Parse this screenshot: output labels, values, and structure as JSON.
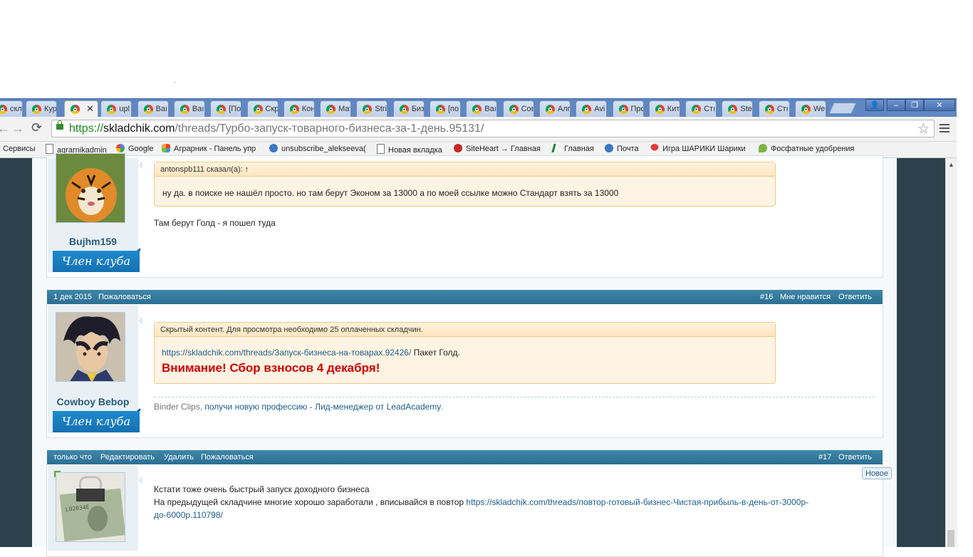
{
  "browser": {
    "tabs": [
      {
        "title": "скл"
      },
      {
        "title": "Кур"
      },
      {
        "title": ""
      },
      {
        "title": "upl"
      },
      {
        "title": "Ваı"
      },
      {
        "title": "Ваı"
      },
      {
        "title": "[По"
      },
      {
        "title": "Скр"
      },
      {
        "title": "Кон"
      },
      {
        "title": "Мат"
      },
      {
        "title": "Stri"
      },
      {
        "title": "Биз"
      },
      {
        "title": "[по"
      },
      {
        "title": "Ваı"
      },
      {
        "title": "Сов"
      },
      {
        "title": "Алг"
      },
      {
        "title": "Avi"
      },
      {
        "title": "Про"
      },
      {
        "title": "Кит"
      },
      {
        "title": "Стı"
      },
      {
        "title": "Ste"
      },
      {
        "title": "Стı"
      },
      {
        "title": "We"
      }
    ],
    "active_tab_close": "✕",
    "window_controls": {
      "user": "👤",
      "minimize": "‒",
      "restore": "❐",
      "close": "✕"
    },
    "url": {
      "scheme": "https://",
      "host": "skladchik.com",
      "path": "/threads/Турбо-запуск-товарного-бизнеса-за-1-день.95131/"
    },
    "nav": {
      "back": "←",
      "forward": "→",
      "reload": "C",
      "star": "☆"
    },
    "bookmarks": [
      {
        "label": "Сервисы",
        "icon": "apps-icon"
      },
      {
        "label": "agrarnikadmin",
        "icon": "page-icon"
      },
      {
        "label": "Google",
        "icon": "google-icon"
      },
      {
        "label": "Аграрник - Панель упр",
        "icon": "joomla-icon"
      },
      {
        "label": "unsubscribe_alekseeva(",
        "icon": "mail-icon"
      },
      {
        "label": "Новая вкладка",
        "icon": "page-icon"
      },
      {
        "label": "SiteHeart → Главная",
        "icon": "siteheart-icon"
      },
      {
        "label": "Главная",
        "icon": "a-icon"
      },
      {
        "label": "Почта",
        "icon": "mail-icon"
      },
      {
        "label": "Игра ШАРИКИ Шарики",
        "icon": "mushroom-icon"
      },
      {
        "label": "Фосфатные удобрения",
        "icon": "plant-icon"
      }
    ]
  },
  "posts": [
    {
      "username": "Bujhm159",
      "badge": "Член клуба",
      "quote_author": "antonspb111 сказал(а): ↑",
      "quote_text": "ну да. в поиске не нашёл просто. но там берут Эконом за 13000 а по моей ссылке можно Стандарт взять за 13000",
      "body": "Там берут Голд - я пошел туда"
    },
    {
      "date": "1 дек 2015",
      "report": "Пожаловаться",
      "number": "#16",
      "like": "Мне нравится",
      "reply": "Ответить",
      "username": "Cowboy Bebop",
      "badge": "Член клуба",
      "hidden_head": "Скрытый контент. Для просмотра необходимо 25 оплаченных складчин.",
      "hidden_link": "https://skladchik.com/threads/Запуск-бизнеса-на-товарах.92426/",
      "hidden_link_suffix": " Пакет Голд.",
      "hidden_warning": "Внимание! Сбор взносов 4 декабря!",
      "signature_prefix": "Binder Clips, ",
      "signature_link": "получи новую профессию - Лид-менеджер от LeadAcademy",
      "signature_suffix": "."
    },
    {
      "date": "только что",
      "edit": "Редактировать",
      "delete": "Удалить",
      "report": "Пожаловаться",
      "number": "#17",
      "reply": "Ответить",
      "new_badge": "Новое",
      "line1": "Кстати тоже очень быстрый запуск доходного бизнеса",
      "line2_prefix": "На предыдущей складчине многие хорошо заработали , вписывайся в повтор ",
      "line2_link_a": "https://skladchik.com/threads/повтор-готовый-бизнес-Чистая-прибыль-в-день-от-3000р-",
      "line2_link_b": "до-6000р.110798/"
    }
  ],
  "colors": {
    "post_bar": "#2c6f92",
    "link": "#1c5d8a",
    "warning": "#d40000",
    "page_bg": "#2c414c"
  }
}
